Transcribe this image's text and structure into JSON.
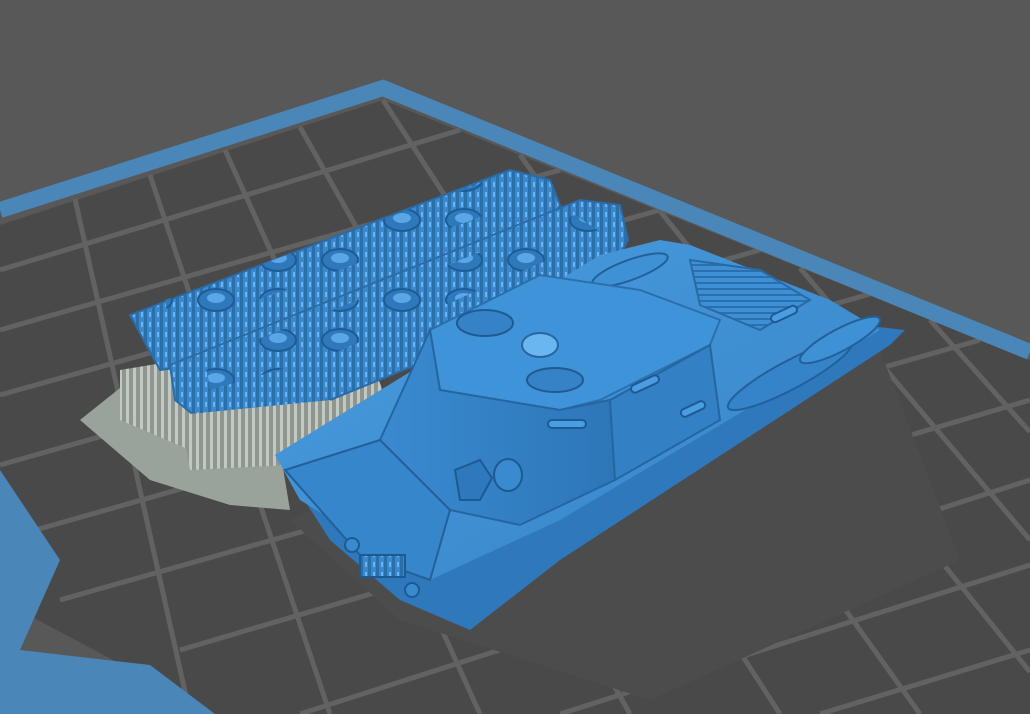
{
  "viewport": {
    "background_color": "#585858",
    "build_plate": {
      "fill_color": "#494949",
      "grid_color": "#626262",
      "border_color": "#4a86b8"
    },
    "shadow_color": "#4c4c4c",
    "support_color": "#a8b0a8"
  },
  "models": [
    {
      "name": "tracks-with-supports",
      "color": "#3d8fd6",
      "has_supports": true
    },
    {
      "name": "tank-hull",
      "color": "#3d8fd6",
      "has_supports": false
    }
  ]
}
